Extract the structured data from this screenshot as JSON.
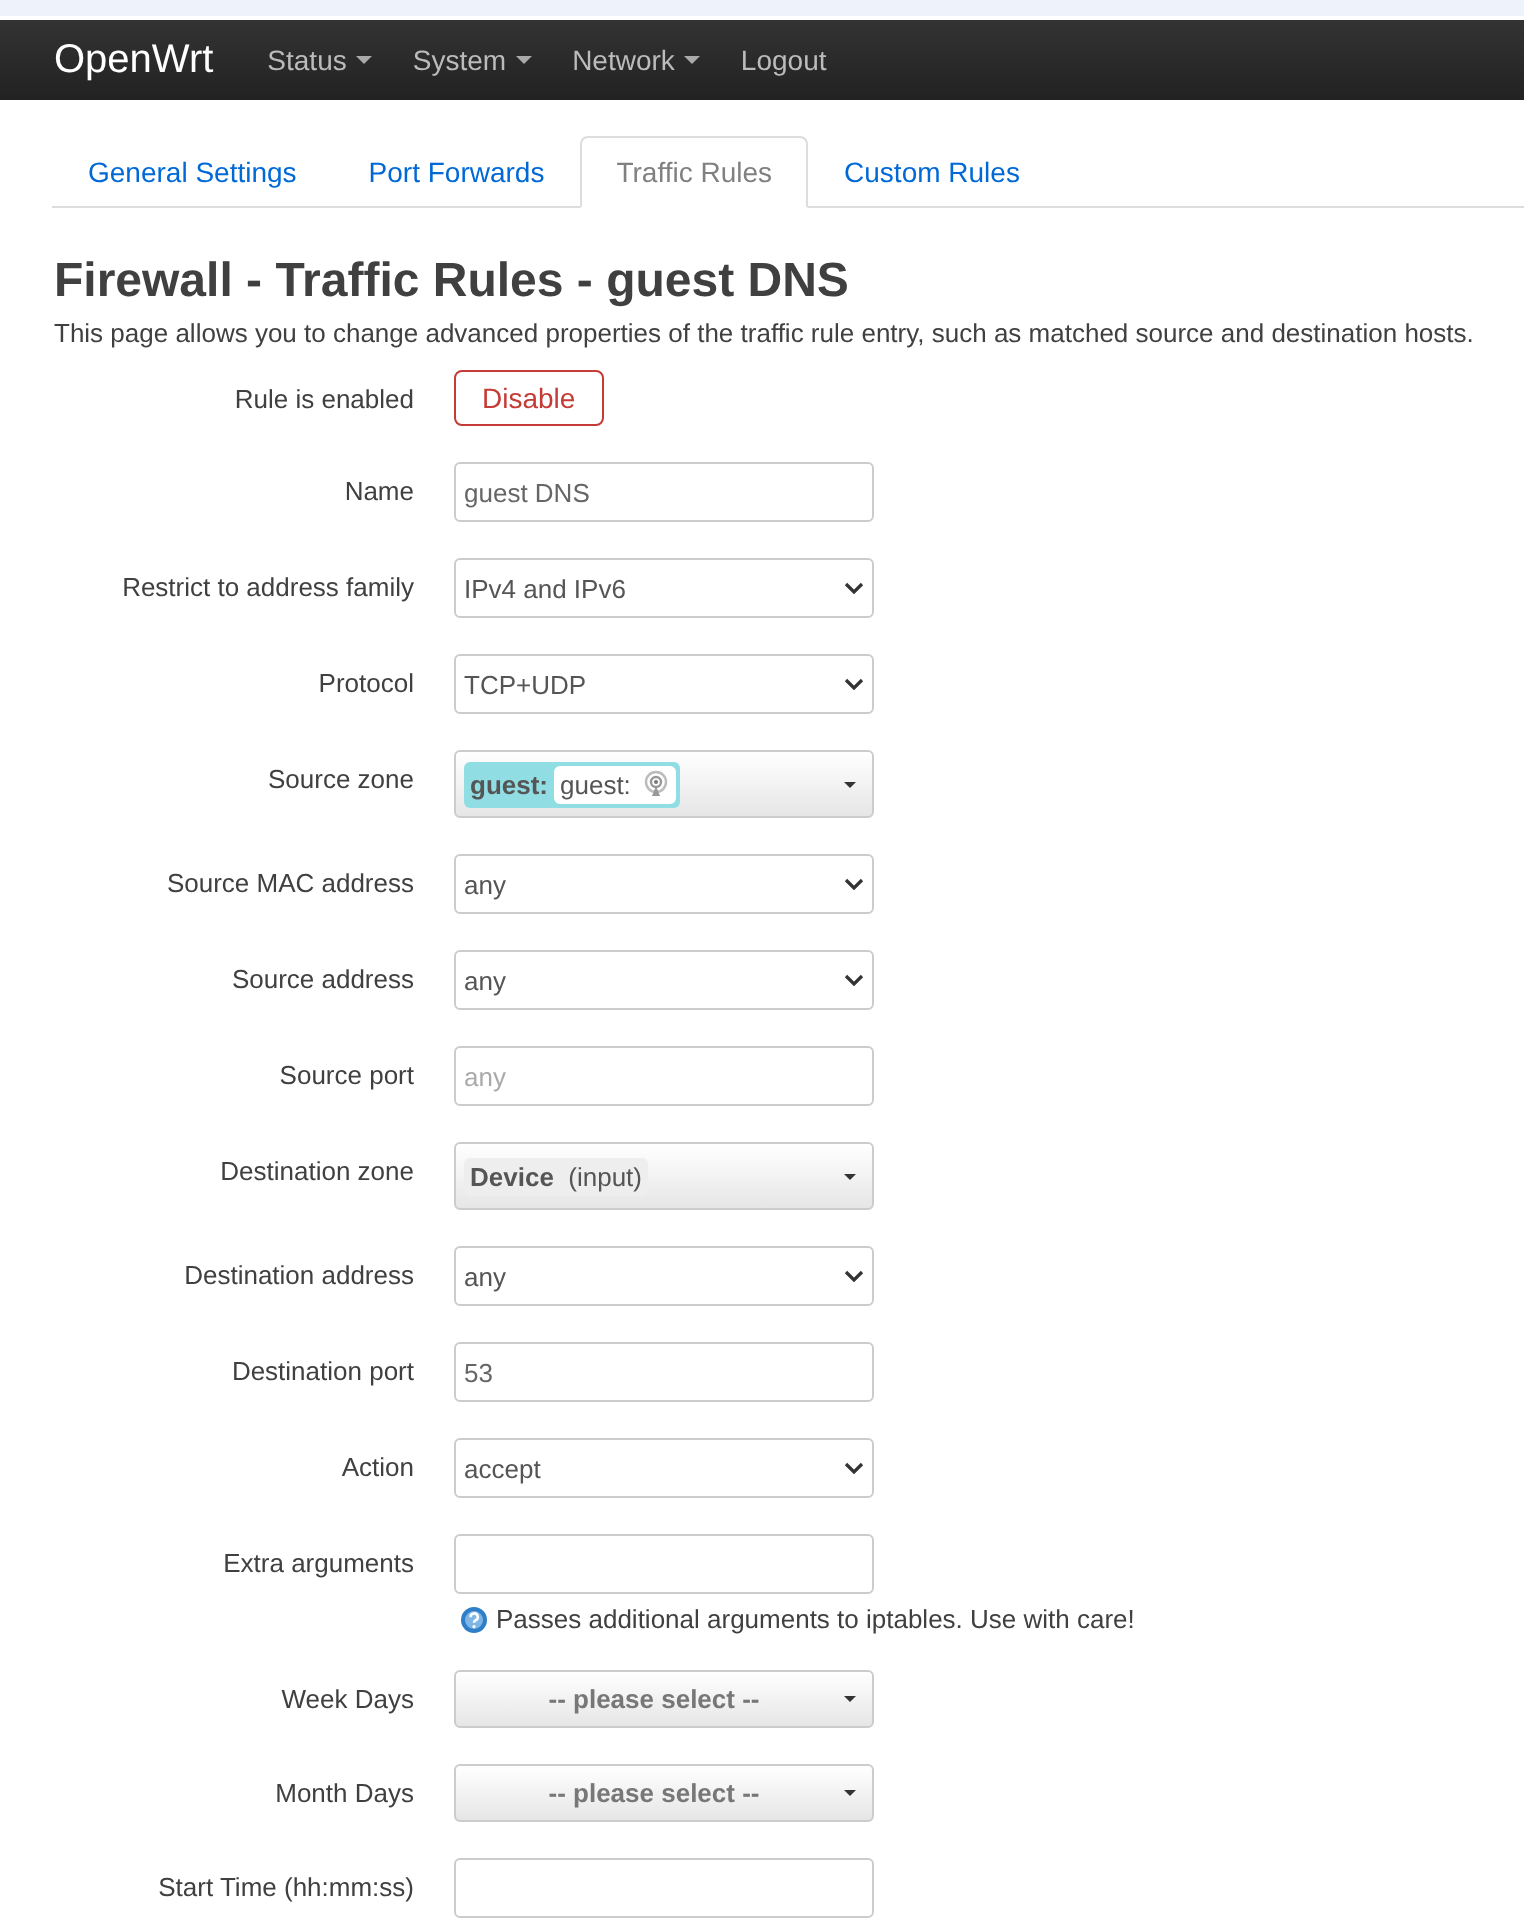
{
  "navbar": {
    "brand": "OpenWrt",
    "menu": [
      {
        "label": "Status",
        "dropdown": true
      },
      {
        "label": "System",
        "dropdown": true
      },
      {
        "label": "Network",
        "dropdown": true
      },
      {
        "label": "Logout",
        "dropdown": false
      }
    ]
  },
  "tabs": [
    {
      "label": "General Settings",
      "selected": false
    },
    {
      "label": "Port Forwards",
      "selected": false
    },
    {
      "label": "Traffic Rules",
      "selected": true
    },
    {
      "label": "Custom Rules",
      "selected": false
    }
  ],
  "title": "Firewall - Traffic Rules - guest DNS",
  "description": "This page allows you to change advanced properties of the traffic rule entry, such as matched source and destination hosts.",
  "rows": [
    {
      "label": "Rule is enabled",
      "kind": "button",
      "value": "Disable"
    },
    {
      "label": "Name",
      "kind": "text",
      "value": "guest DNS"
    },
    {
      "label": "Restrict to address family",
      "kind": "select",
      "value": "IPv4 and IPv6"
    },
    {
      "label": "Protocol",
      "kind": "select",
      "value": "TCP+UDP"
    },
    {
      "label": "Source zone",
      "kind": "zone",
      "zone": "guest:",
      "network": "guest:"
    },
    {
      "label": "Source MAC address",
      "kind": "select",
      "value": "any"
    },
    {
      "label": "Source address",
      "kind": "select",
      "value": "any"
    },
    {
      "label": "Source port",
      "kind": "text",
      "placeholder": "any"
    },
    {
      "label": "Destination zone",
      "kind": "device",
      "name": "Device",
      "note": "(input)"
    },
    {
      "label": "Destination address",
      "kind": "select",
      "value": "any"
    },
    {
      "label": "Destination port",
      "kind": "text",
      "value": "53"
    },
    {
      "label": "Action",
      "kind": "select",
      "value": "accept"
    },
    {
      "label": "Extra arguments",
      "kind": "text",
      "hint": "Passes additional arguments to iptables. Use with care!"
    },
    {
      "label": "Week Days",
      "kind": "multi",
      "value": "-- please select --"
    },
    {
      "label": "Month Days",
      "kind": "multi",
      "value": "-- please select --"
    },
    {
      "label": "Start Time (hh:mm:ss)",
      "kind": "text"
    }
  ]
}
